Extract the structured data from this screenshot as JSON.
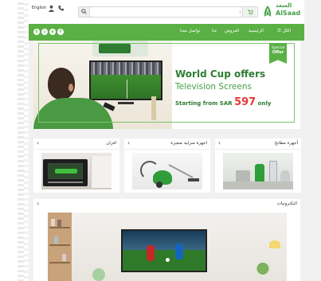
{
  "header": {
    "lang_label": "English",
    "search_placeholder": "عما تبحث ؟",
    "logo_ar": "السعد",
    "logo_en": "AlSaad"
  },
  "nav": {
    "menu_all": "☰ الكل",
    "home": "الرئيسية",
    "offers": "العروض",
    "about": "عنا",
    "contact": "تواصل معنا"
  },
  "hero": {
    "badge_line1": "Special",
    "badge_line2": "Offer",
    "title": "World Cup offers",
    "subtitle": "Television Screens",
    "from_text": "Starting from SAR",
    "price": "597",
    "only": "only"
  },
  "categories": [
    {
      "title": "أجهزة مطابخ"
    },
    {
      "title": "اجهزة منزلية صغيرة"
    },
    {
      "title": "افران"
    }
  ],
  "electronics": {
    "title": "اليكترونيات"
  },
  "colors": {
    "brand_green": "#5bb045",
    "dark_green": "#2e7d32",
    "price_red": "#e53935"
  },
  "icons": {
    "card_arrow": "‹",
    "search": "search-icon",
    "user": "user-icon",
    "phone": "phone-icon",
    "cart": "cart-icon"
  }
}
